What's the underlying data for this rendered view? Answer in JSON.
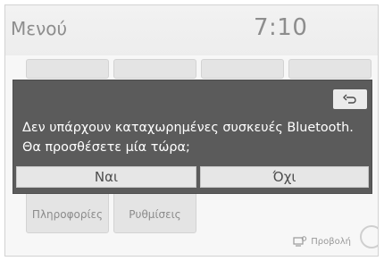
{
  "header": {
    "title": "Μενού",
    "time": "7:10"
  },
  "tiles": [
    {
      "label": ""
    },
    {
      "label": ""
    },
    {
      "label": ""
    },
    {
      "label": ""
    },
    {
      "label": "Πληροφορίες"
    },
    {
      "label": "Ρυθμίσεις"
    }
  ],
  "footer": {
    "view_label": "Προβολή"
  },
  "dialog": {
    "message_line1": "Δεν υπάρχουν καταχωρημένες συσκευές Bluetooth.",
    "message_line2": "Θα προσθέσετε μία τώρα;",
    "yes_label": "Ναι",
    "no_label": "Όχι",
    "back_icon": "return-arrow-icon"
  },
  "colors": {
    "dialog_bg": "#5b5b5b",
    "button_bg": "#e6e6e6"
  }
}
